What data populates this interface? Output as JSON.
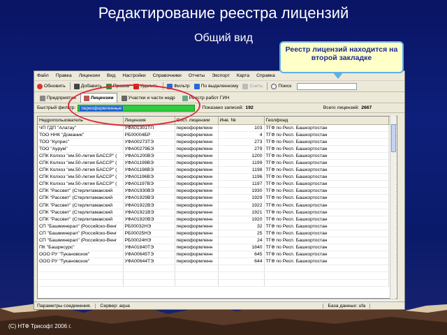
{
  "slide": {
    "title": "Редактирование реестра лицензий",
    "subtitle": "Общий вид",
    "callout": "Реестр лицензий находится на второй закладке",
    "footer": "(C) НТФ Трисофт 2006 г."
  },
  "menu": [
    "Файл",
    "Правка",
    "Лицензии",
    "Вид",
    "Настройки",
    "Справочники",
    "Отчеты",
    "Экспорт",
    "Карта",
    "Справка"
  ],
  "toolbar": {
    "refresh": "Обновить",
    "add": "Добавить",
    "edit": "Правка",
    "delete": "Удалить",
    "filter": "Фильтр",
    "by_selected": "По выделенному",
    "clear": "Снять",
    "search": "Поиск"
  },
  "tabs": [
    "Предприятия",
    "Лицензии",
    "Участки и части недр",
    "Реестр работ ГИН"
  ],
  "filterbar": {
    "label": "Быстрый фильтр:",
    "value": "переоформленные",
    "shown_label": "Показано записей:",
    "shown_count": "192",
    "total_label": "Всего лицензий:",
    "total_count": "2667"
  },
  "grid": {
    "columns": [
      "Недропользователь",
      "Лицензия",
      "Сост. лицензии",
      "Инв. №",
      "Геолфонд",
      "Да"
    ],
    "rows": [
      [
        "ЧП ГДП \"Алатау\"",
        "УФА01301ТП",
        "переоформленн",
        "103",
        "ТГФ по Респ. Башкортостан",
        "19."
      ],
      [
        "ТОО ННК \"Доманик\"",
        "РБ00004БР",
        "переоформленн",
        "4",
        "ТГФ по Респ. Башкортостан",
        "05."
      ],
      [
        "ТОО \"Куприс\"",
        "УФА00273ТЭ",
        "переоформленн",
        "273",
        "ТГФ по Респ. Башкортостан",
        "19."
      ],
      [
        "ТОО \"Аурум\"",
        "УФА00279БЭ",
        "переоформленн",
        "279",
        "ТГФ по Респ. Башкортостан",
        "26."
      ],
      [
        "СПК Колхоз \"им.50-летия БАССР\" (",
        "УФА01200ВЭ",
        "переоформленн",
        "1200",
        "ТГФ по Респ. Башкортостан",
        "01."
      ],
      [
        "СПК Колхоз \"им.50-летия БАССР\" (",
        "УФА01199ВЭ",
        "переоформленн",
        "1199",
        "ТГФ по Респ. Башкортостан",
        "01."
      ],
      [
        "СПК Колхоз \"им.50-летия БАССР\" (",
        "УФА01198ВЭ",
        "переоформленн",
        "1198",
        "ТГФ по Респ. Башкортостан",
        "01."
      ],
      [
        "СПК Колхоз \"им.50-летия БАССР\" (",
        "УФА01196ВЭ",
        "переоформленн",
        "1196",
        "ТГФ по Респ. Башкортостан",
        "01."
      ],
      [
        "СПК Колхоз \"им.50-летия БАССР\" (",
        "УФА01197ВЭ",
        "переоформленн",
        "1197",
        "ТГФ по Респ. Башкортостан",
        "01."
      ],
      [
        "СПК \"Рассвет\" (Стерлитамакский",
        "УФА01930ВЭ",
        "переоформленн",
        "1930",
        "ТГФ по Респ. Башкортостан",
        "01."
      ],
      [
        "СПК \"Рассвет\" (Стерлитамакский",
        "УФА01929ВЭ",
        "переоформленн",
        "1929",
        "ТГФ по Респ. Башкортостан",
        "01."
      ],
      [
        "СПК \"Рассвет\" (Стерлитамакский",
        "УФА01922ВЭ",
        "переоформленн",
        "1922",
        "ТГФ по Респ. Башкортостан",
        "01."
      ],
      [
        "СПК \"Рассвет\" (Стерлитамакский",
        "УФА01921ВЭ",
        "переоформленн",
        "1921",
        "ТГФ по Респ. Башкортостан",
        "01."
      ],
      [
        "СПК \"Рассвет\" (Стерлитамакский",
        "УФА01920ВЭ",
        "переоформленн",
        "1920",
        "ТГФ по Респ. Башкортостан",
        "01."
      ],
      [
        "СП \"Башминерал\" (Российско-Венг",
        "РБ00032НЭ",
        "переоформленн",
        "32",
        "ТГФ по Респ. Башкортостан",
        "01."
      ],
      [
        "СП \"Башминерал\" (Российско-Венг",
        "РБ00025НЭ",
        "переоформленн",
        "25",
        "ТГФ по Респ. Башкортостан",
        "01."
      ],
      [
        "СП \"Башминерал\" (Российско-Венг",
        "РБ00024НЭ",
        "переоформленн",
        "24",
        "ТГФ по Респ. Башкортостан",
        "01."
      ],
      [
        "ПК \"Башресурс\"",
        "УФА01840ТЭ",
        "переоформленн",
        "1840",
        "ТГФ по Респ. Башкортостан",
        "01."
      ],
      [
        "ООО РУ \"Тукановское\"",
        "УФА00645ТЭ",
        "переоформленн",
        "645",
        "ТГФ по Респ. Башкортостан",
        "01."
      ],
      [
        "ООО РУ \"Тукановское\"",
        "УФА00644ТЭ",
        "переоформленн",
        "644",
        "ТГФ по Респ. Башкортостан",
        "01."
      ],
      [
        "",
        "",
        "",
        "",
        "",
        ""
      ],
      [
        "",
        "",
        "",
        "",
        "",
        ""
      ],
      [
        "",
        "",
        "",
        "",
        "",
        ""
      ]
    ]
  },
  "status": {
    "params": "Параметры соединения.",
    "server": "Сервер: aqua",
    "db": "База данных: ufa"
  }
}
